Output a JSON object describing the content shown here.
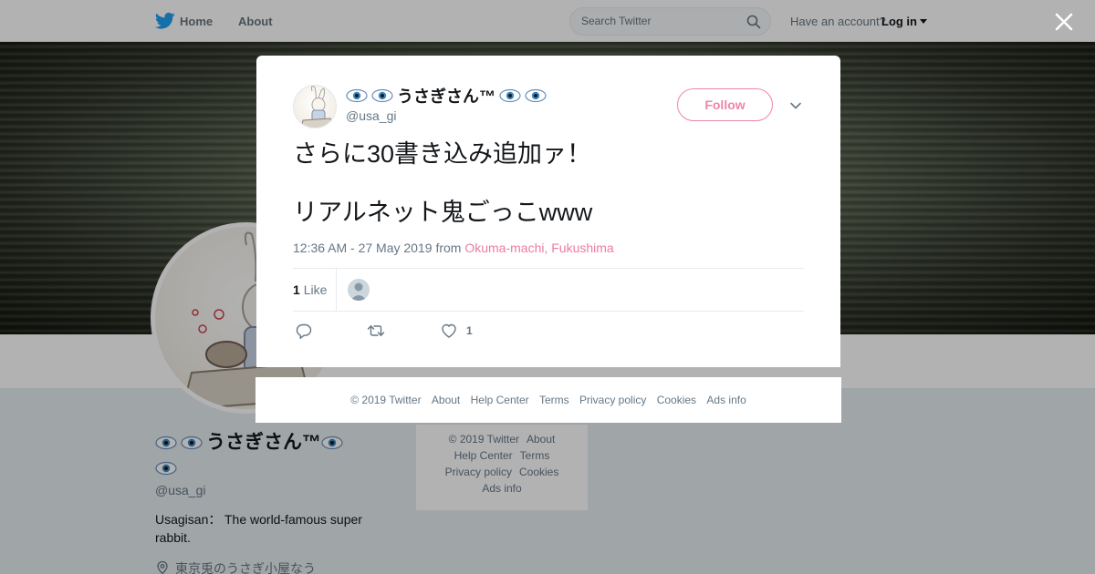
{
  "nav": {
    "home": "Home",
    "about": "About",
    "search_placeholder": "Search Twitter",
    "have_account": "Have an account?",
    "login": "Log in"
  },
  "profile": {
    "name": "うさぎさん™",
    "handle": "@usa_gi",
    "bio": "Usagisan： The world-famous super rabbit.",
    "location": "東京兎のうさぎ小屋なう"
  },
  "bg_footer": [
    "© 2019 Twitter",
    "About",
    "Help Center",
    "Terms",
    "Privacy policy",
    "Cookies",
    "Ads info"
  ],
  "tweet": {
    "author_name": "うさぎさん™",
    "author_handle": "@usa_gi",
    "follow_label": "Follow",
    "text_line1": "さらに30書き込み追加ァ！",
    "text_line2": "リアルネット鬼ごっこwww",
    "timestamp": "12:36 AM - 27 May 2019",
    "from_word": "from",
    "location": "Okuma-machi, Fukushima",
    "likes_count": "1",
    "likes_label": "Like",
    "like_action_count": "1"
  },
  "modal_footer": [
    "© 2019 Twitter",
    "About",
    "Help Center",
    "Terms",
    "Privacy policy",
    "Cookies",
    "Ads info"
  ],
  "colors": {
    "twitter_blue": "#1da1f2",
    "accent_pink": "#e0245e",
    "text_secondary": "#657786"
  },
  "icons": [
    "twitter-bird-icon",
    "search-icon",
    "eye-icon",
    "chevron-down-icon",
    "reply-icon",
    "retweet-icon",
    "heart-icon",
    "location-pin-icon",
    "close-icon"
  ]
}
